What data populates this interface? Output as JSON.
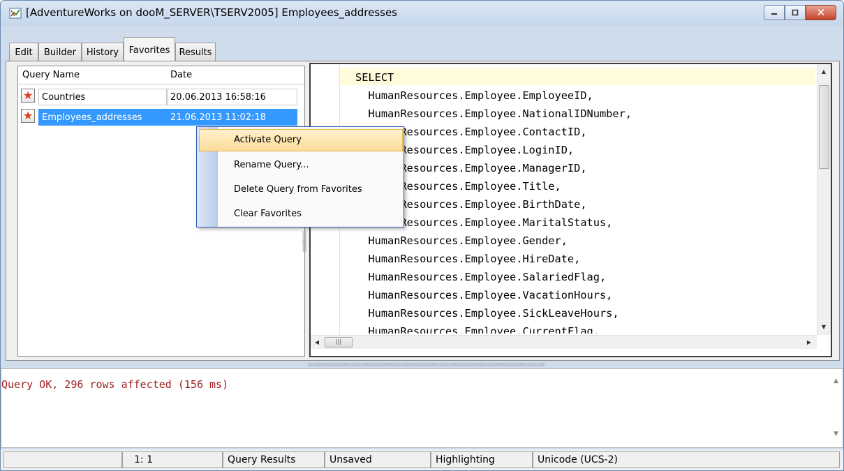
{
  "window": {
    "title": "[AdventureWorks on dooM_SERVER\\TSERV2005] Employees_addresses"
  },
  "tabs": [
    {
      "label": "Edit"
    },
    {
      "label": "Builder"
    },
    {
      "label": "History"
    },
    {
      "label": "Favorites",
      "active": true
    },
    {
      "label": "Results"
    }
  ],
  "favorites": {
    "columns": {
      "name": "Query Name",
      "date": "Date"
    },
    "rows": [
      {
        "name": "Countries",
        "date": "20.06.2013 16:58:16",
        "icon": "favorite-star-icon"
      },
      {
        "name": "Employees_addresses",
        "date": "21.06.2013 11:02:18",
        "icon": "favorite-star-icon",
        "selected": true
      }
    ]
  },
  "context_menu": {
    "items": [
      {
        "label": "Activate Query",
        "highlighted": true
      },
      {
        "label": "Rename Query..."
      },
      {
        "label": "Delete Query from Favorites"
      },
      {
        "label": "Clear Favorites"
      }
    ]
  },
  "editor": {
    "lines": [
      "SELECT",
      "  HumanResources.Employee.EmployeeID,",
      "  HumanResources.Employee.NationalIDNumber,",
      "  HumanResources.Employee.ContactID,",
      "  HumanResources.Employee.LoginID,",
      "  HumanResources.Employee.ManagerID,",
      "  HumanResources.Employee.Title,",
      "  HumanResources.Employee.BirthDate,",
      "  HumanResources.Employee.MaritalStatus,",
      "  HumanResources.Employee.Gender,",
      "  HumanResources.Employee.HireDate,",
      "  HumanResources.Employee.SalariedFlag,",
      "  HumanResources.Employee.VacationHours,",
      "  HumanResources.Employee.SickLeaveHours,",
      "  HumanResources.Employee.CurrentFlag,"
    ]
  },
  "messages": {
    "text": "Query OK, 296 rows affected (156 ms)"
  },
  "statusbar": {
    "position": "1:  1",
    "mode": "Query Results",
    "saved": "Unsaved",
    "highlighting": "Highlighting",
    "encoding": "Unicode (UCS-2)"
  },
  "colors": {
    "selection": "#3399ff",
    "message": "#a02323",
    "star": "#e53b1c",
    "current_line": "#fffbdb"
  }
}
